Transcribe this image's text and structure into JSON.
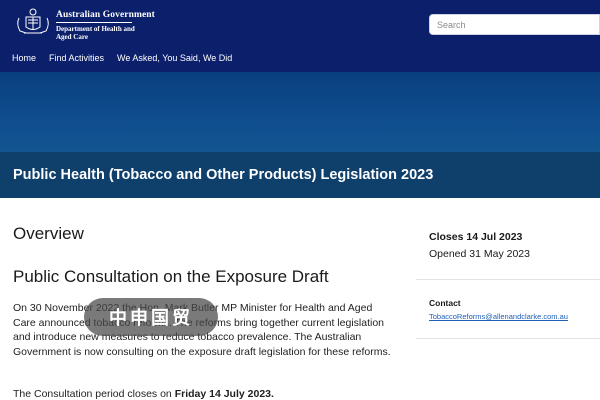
{
  "header": {
    "gov_title": "Australian Government",
    "dept_name": "Department of Health and Aged Care",
    "search_placeholder": "Search"
  },
  "nav": {
    "items": [
      "Home",
      "Find Activities",
      "We Asked, You Said, We Did"
    ]
  },
  "page": {
    "title": "Public Health (Tobacco and Other Products) Legislation 2023"
  },
  "main": {
    "overview_heading": "Overview",
    "sub_heading": "Public Consultation on the Exposure Draft",
    "body": "On 30 November 2022 the Hon. Mark Butler MP Minister for Health and Aged Care announced tobacco reforms. The reforms bring together current legislation and introduce new measures to reduce tobacco prevalence. The Australian Government is now consulting on the exposure draft legislation for these reforms.",
    "closes_prefix": "The Consultation period closes on ",
    "closes_bold": "Friday 14 July 2023."
  },
  "watermark": {
    "text": "中申国贸"
  },
  "sidebar": {
    "closes": "Closes 14 Jul 2023",
    "opened": "Opened 31 May 2023",
    "contact_label": "Contact",
    "contact_email": "TobaccoReforms@allenandclarke.com.au"
  },
  "colors": {
    "header_bg": "#0b1f6b",
    "banner_bg": "#0f4d8f",
    "title_bar_bg": "#0f3f6b",
    "link": "#1f5fb8"
  },
  "icons": {
    "crest": "coat-of-arms-icon"
  }
}
